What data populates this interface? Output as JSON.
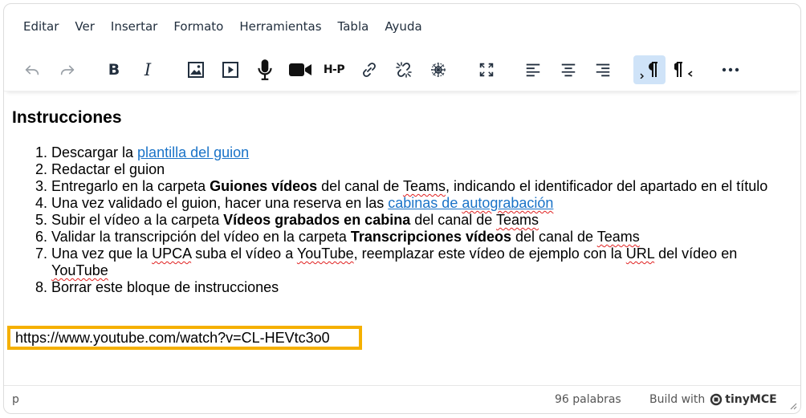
{
  "menubar": {
    "items": [
      "Editar",
      "Ver",
      "Insertar",
      "Formato",
      "Herramientas",
      "Tabla",
      "Ayuda"
    ]
  },
  "toolbar": {
    "buttons": [
      "undo-icon",
      "redo-icon",
      "bold-icon",
      "italic-icon",
      "image-icon",
      "video-icon",
      "microphone-icon",
      "camera-icon",
      "h5p-icon",
      "link-icon",
      "unlink-icon",
      "accessibility-icon",
      "fullscreen-icon",
      "align-left-icon",
      "align-center-icon",
      "align-right-icon",
      "ltr-icon",
      "rtl-icon",
      "more-icon"
    ],
    "bold_label": "B",
    "italic_label": "I",
    "h5p_label": "H-P",
    "ltr_active": true,
    "accent": "#cfe3f8"
  },
  "content": {
    "heading": "Instrucciones",
    "steps": {
      "s1": {
        "text": "Descargar la ",
        "link": "plantilla del guion"
      },
      "s2": {
        "text": "Redactar el guion"
      },
      "s3": {
        "pre": "Entregarlo en la carpeta ",
        "bold": "Guiones vídeos",
        "mid": " del canal de ",
        "teams": "Teams",
        "post": ", indicando el identificador del apartado en el título"
      },
      "s4": {
        "text": "Una vez validado el guion, hacer una reserva en las ",
        "link_a": "cabinas de ",
        "link_b": "autograbación"
      },
      "s5": {
        "pre": "Subir el vídeo a la carpeta ",
        "bold": "Vídeos grabados en cabina",
        "mid": " del canal de ",
        "teams": "Teams"
      },
      "s6": {
        "pre": "Validar la transcripción del vídeo en la carpeta ",
        "bold": "Transcripciones vídeos",
        "mid": " del canal de ",
        "teams": "Teams"
      },
      "s7": {
        "a": "Una vez que la ",
        "upca": "UPCA",
        "b": " suba el vídeo a ",
        "yt1": "YouTube",
        "c": ", reemplazar este vídeo de ejemplo con la ",
        "url": "URL",
        "d": " del vídeo en ",
        "yt2": "YouTube"
      },
      "s8": {
        "text": "Borrar este bloque de instrucciones"
      }
    },
    "url_text": "https://www.youtube.com/watch?v=CL-HEVtc3o0",
    "highlight_color": "#f5b000",
    "link_color": "#1a73c8"
  },
  "statusbar": {
    "path": "p",
    "word_count": "96 palabras",
    "brand_prefix": "Build with",
    "brand_name": "tinyMCE"
  }
}
